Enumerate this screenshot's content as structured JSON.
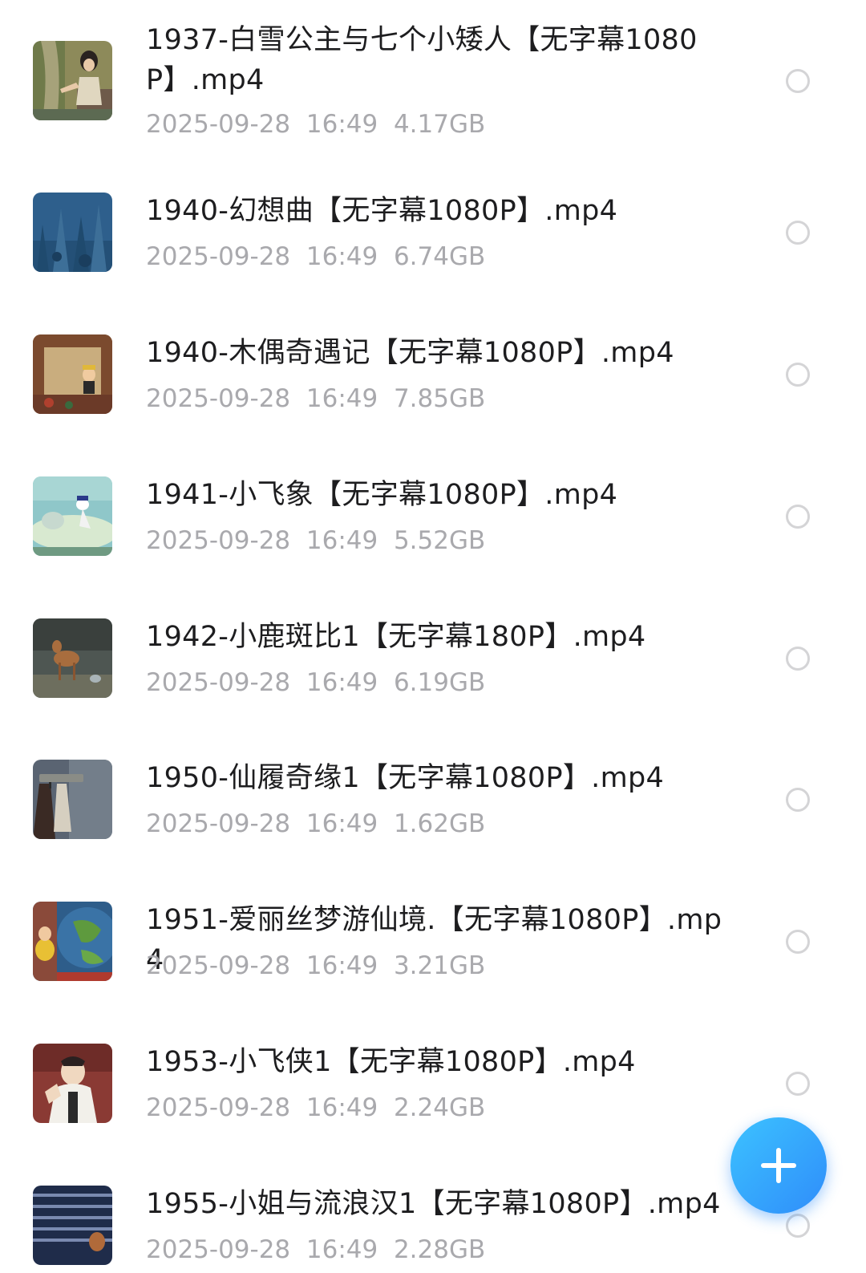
{
  "files": [
    {
      "name": "1937-白雪公主与七个小矮人【无字幕1080P】.mp4",
      "date": "2025-09-28",
      "time": "16:49",
      "size": "4.17GB",
      "thumbnail": "snow-white-thumbnail",
      "selected": false
    },
    {
      "name": "1940-幻想曲【无字幕1080P】.mp4",
      "date": "2025-09-28",
      "time": "16:49",
      "size": "6.74GB",
      "thumbnail": "fantasia-thumbnail",
      "selected": false
    },
    {
      "name": "1940-木偶奇遇记【无字幕1080P】.mp4",
      "date": "2025-09-28",
      "time": "16:49",
      "size": "7.85GB",
      "thumbnail": "pinocchio-thumbnail",
      "selected": false
    },
    {
      "name": "1941-小飞象【无字幕1080P】.mp4",
      "date": "2025-09-28",
      "time": "16:49",
      "size": "5.52GB",
      "thumbnail": "dumbo-thumbnail",
      "selected": false
    },
    {
      "name": "1942-小鹿斑比1【无字幕180P】.mp4",
      "date": "2025-09-28",
      "time": "16:49",
      "size": "6.19GB",
      "thumbnail": "bambi-thumbnail",
      "selected": false
    },
    {
      "name": "1950-仙履奇缘1【无字幕1080P】.mp4",
      "date": "2025-09-28",
      "time": "16:49",
      "size": "1.62GB",
      "thumbnail": "cinderella-thumbnail",
      "selected": false
    },
    {
      "name": "1951-爱丽丝梦游仙境.【无字幕1080P】.mp4",
      "date": "2025-09-28",
      "time": "16:49",
      "size": "3.21GB",
      "thumbnail": "alice-thumbnail",
      "selected": false
    },
    {
      "name": "1953-小飞侠1【无字幕1080P】.mp4",
      "date": "2025-09-28",
      "time": "16:49",
      "size": "2.24GB",
      "thumbnail": "peter-pan-thumbnail",
      "selected": false
    },
    {
      "name": "1955-小姐与流浪汉1【无字幕1080P】.mp4",
      "date": "2025-09-28",
      "time": "16:49",
      "size": "2.28GB",
      "thumbnail": "lady-and-tramp-thumbnail",
      "selected": false
    }
  ],
  "fab": {
    "icon": "plus-icon",
    "color": "#2f8dfa"
  },
  "colors": {
    "name_text": "#1d1d1f",
    "meta_text": "#a9a9ad",
    "radio_border": "#d4d4d6"
  }
}
